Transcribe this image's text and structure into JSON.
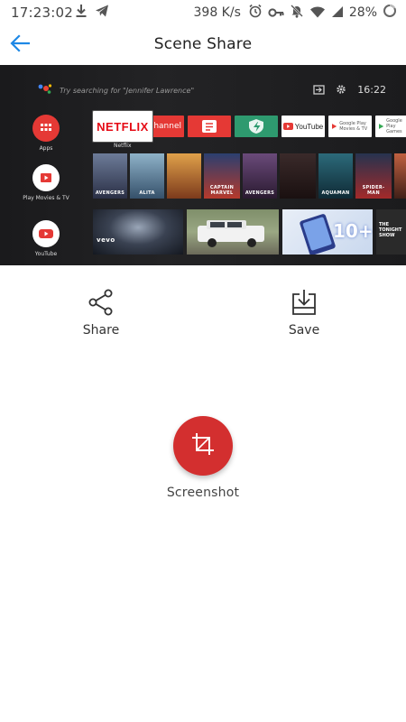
{
  "status_bar": {
    "time": "17:23:02",
    "network_speed": "398 K/s",
    "battery": "28%",
    "left_icons": [
      "download-icon",
      "telegram-icon"
    ],
    "right_icons": [
      "alarm-icon",
      "vpn-key-icon",
      "notifications-off-icon",
      "wifi-icon",
      "signal-icon",
      "battery-icon"
    ]
  },
  "app_bar": {
    "title": "Scene Share",
    "back_icon": "arrow-back-icon",
    "accent_color": "#1e88e5"
  },
  "tv_preview": {
    "search_hint": "Try searching for \"Jennifer Lawrence\"",
    "clock": "16:22",
    "apps": [
      {
        "label": "Apps",
        "icon": "grid-icon",
        "color": "#e53935"
      },
      {
        "label": "Play Movies & TV",
        "icon": "play-movies-icon",
        "color": "#ffffff"
      },
      {
        "label": "YouTube",
        "icon": "youtube-icon",
        "color": "#ffffff"
      }
    ],
    "channel_tiles": {
      "netflix": "NETFLIX",
      "netflix_label": "Netflix",
      "channel": "Channel",
      "youtube": "YouTube",
      "google_play_movies": "Google Play Movies & TV",
      "google_play_games": "Google Play Games"
    },
    "posters": [
      "AVENGERS",
      "ALITA",
      "",
      "CAPTAIN MARVEL",
      "AVENGERS",
      "",
      "AQUAMAN",
      "SPIDER-MAN"
    ],
    "video_tiles": {
      "vevo": "vevo",
      "promo": "10+",
      "tonight_show": "THE TONIGHT SHOW"
    }
  },
  "actions": {
    "share_label": "Share",
    "save_label": "Save",
    "screenshot_label": "Screenshot"
  },
  "colors": {
    "screenshot_button": "#d32f2f",
    "netflix_red": "#e50914"
  }
}
